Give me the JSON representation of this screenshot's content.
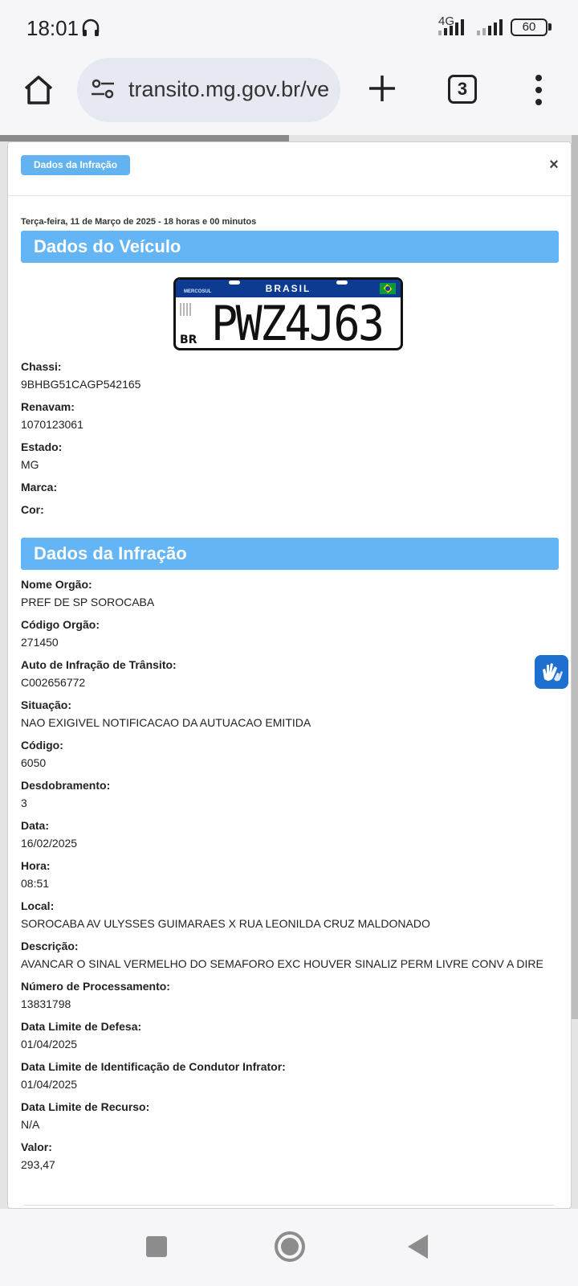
{
  "status": {
    "time": "18:01",
    "network": "4G",
    "battery": "60"
  },
  "browser": {
    "url": "transito.mg.gov.br/ve",
    "tab_count": "3"
  },
  "modal": {
    "badge": "Dados da Infração",
    "close": "×",
    "date_line": "Terça-feira, 11 de Março de 2025 - 18 horas e 00 minutos",
    "vehicle_section_title": "Dados do Veículo",
    "plate": {
      "country": "BRASIL",
      "mercosul": "MERCOSUL",
      "br": "BR",
      "number": "PWZ4J63"
    },
    "vehicle_fields": [
      {
        "label": "Chassi:",
        "value": "9BHBG51CAGP542165"
      },
      {
        "label": "Renavam:",
        "value": "1070123061"
      },
      {
        "label": "Estado:",
        "value": "MG"
      },
      {
        "label": "Marca:",
        "value": ""
      },
      {
        "label": "Cor:",
        "value": ""
      }
    ],
    "infraction_section_title": "Dados da Infração",
    "infraction_fields": [
      {
        "label": "Nome Orgão:",
        "value": "PREF DE SP SOROCABA"
      },
      {
        "label": "Código Orgão:",
        "value": "271450"
      },
      {
        "label": "Auto de Infração de Trânsito:",
        "value": "C002656772"
      },
      {
        "label": "Situação:",
        "value": "NAO EXIGIVEL NOTIFICACAO DA AUTUACAO EMITIDA"
      },
      {
        "label": "Código:",
        "value": "6050"
      },
      {
        "label": "Desdobramento:",
        "value": "3"
      },
      {
        "label": "Data:",
        "value": "16/02/2025"
      },
      {
        "label": "Hora:",
        "value": "08:51"
      },
      {
        "label": "Local:",
        "value": "SOROCABA AV ULYSSES GUIMARAES X RUA LEONILDA CRUZ MALDONADO"
      },
      {
        "label": "Descrição:",
        "value": "AVANCAR O SINAL VERMELHO DO SEMAFORO EXC HOUVER SINALIZ PERM LIVRE CONV A DIRE"
      },
      {
        "label": "Número de Processamento:",
        "value": "13831798"
      },
      {
        "label": "Data Limite de Defesa:",
        "value": "01/04/2025"
      },
      {
        "label": "Data Limite de Identificação de Condutor Infrator:",
        "value": "01/04/2025"
      },
      {
        "label": "Data Limite de Recurso:",
        "value": "N/A"
      },
      {
        "label": "Valor:",
        "value": "293,47"
      }
    ]
  }
}
